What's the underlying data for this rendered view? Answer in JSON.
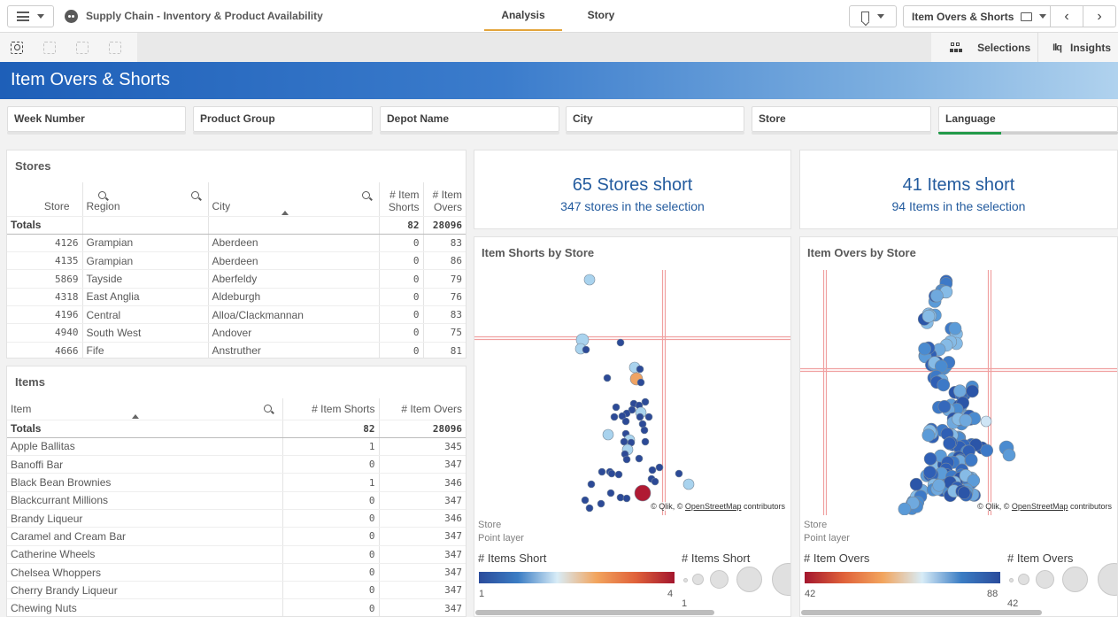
{
  "app": {
    "title": "Supply Chain - Inventory & Product Availability",
    "tabs": [
      {
        "label": "Analysis",
        "active": true
      },
      {
        "label": "Story",
        "active": false
      }
    ],
    "sheet_selector": "Item Overs & Shorts",
    "toolbar_right": {
      "selections_label": "Selections",
      "insights_label": "Insights"
    }
  },
  "sheet": {
    "title": "Item Overs & Shorts"
  },
  "filters": [
    {
      "label": "Week Number"
    },
    {
      "label": "Product Group"
    },
    {
      "label": "Depot Name"
    },
    {
      "label": "City"
    },
    {
      "label": "Store"
    },
    {
      "label": "Language",
      "selected_fraction": 0.35
    }
  ],
  "stores_table": {
    "title": "Stores",
    "columns": [
      "Store",
      "Region",
      "City",
      "# Item Shorts",
      "# Item Overs"
    ],
    "totals": {
      "label": "Totals",
      "shorts": "82",
      "overs": "28096"
    },
    "rows": [
      {
        "store": "4126",
        "region": "Grampian",
        "city": "Aberdeen",
        "shorts": "0",
        "overs": "83"
      },
      {
        "store": "4135",
        "region": "Grampian",
        "city": "Aberdeen",
        "shorts": "0",
        "overs": "86"
      },
      {
        "store": "5869",
        "region": "Tayside",
        "city": "Aberfeldy",
        "shorts": "0",
        "overs": "79"
      },
      {
        "store": "4318",
        "region": "East Anglia",
        "city": "Aldeburgh",
        "shorts": "0",
        "overs": "76"
      },
      {
        "store": "4196",
        "region": "Central",
        "city": "Alloa/Clackmannan",
        "shorts": "0",
        "overs": "83"
      },
      {
        "store": "4940",
        "region": "South West",
        "city": "Andover",
        "shorts": "0",
        "overs": "75"
      },
      {
        "store": "4666",
        "region": "Fife",
        "city": "Anstruther",
        "shorts": "0",
        "overs": "81"
      }
    ]
  },
  "items_table": {
    "title": "Items",
    "columns": [
      "Item",
      "# Item Shorts",
      "# Item Overs"
    ],
    "totals": {
      "label": "Totals",
      "shorts": "82",
      "overs": "28096"
    },
    "rows": [
      {
        "item": "Apple Ballitas",
        "shorts": "1",
        "overs": "345"
      },
      {
        "item": "Banoffi Bar",
        "shorts": "0",
        "overs": "347"
      },
      {
        "item": "Black Bean Brownies",
        "shorts": "1",
        "overs": "346"
      },
      {
        "item": "Blackcurrant Millions",
        "shorts": "0",
        "overs": "347"
      },
      {
        "item": "Brandy Liqueur",
        "shorts": "0",
        "overs": "346"
      },
      {
        "item": "Caramel and Cream Bar",
        "shorts": "0",
        "overs": "347"
      },
      {
        "item": "Catherine Wheels",
        "shorts": "0",
        "overs": "347"
      },
      {
        "item": "Chelsea Whoppers",
        "shorts": "0",
        "overs": "347"
      },
      {
        "item": "Cherry Brandy Liqueur",
        "shorts": "0",
        "overs": "347"
      },
      {
        "item": "Chewing Nuts",
        "shorts": "0",
        "overs": "347"
      }
    ]
  },
  "kpis": [
    {
      "main": "65 Stores short",
      "sub": "347 stores in the selection"
    },
    {
      "main": "41 Items short",
      "sub": "94 Items in the selection"
    }
  ],
  "maps": [
    {
      "title": "Item Shorts by Store",
      "attribution_prefix": "© Qlik, © ",
      "attribution_link": "OpenStreetMap",
      "attribution_suffix": " contributors",
      "layer_name": "Store",
      "layer_type": "Point layer",
      "color_legend_title": "# Items Short",
      "color_min": "1",
      "color_max": "4",
      "size_legend_title": "# Items Short",
      "size_min": "1",
      "gradient": [
        "#2a4b9b",
        "#3b7dc4",
        "#d8ecf7",
        "#f2a55e",
        "#e0623a",
        "#a3162e"
      ]
    },
    {
      "title": "Item Overs by Store",
      "attribution_prefix": "© Qlik, © ",
      "attribution_link": "OpenStreetMap",
      "attribution_suffix": " contributors",
      "layer_name": "Store",
      "layer_type": "Point layer",
      "color_legend_title": "# Item Overs",
      "color_min": "42",
      "color_max": "88",
      "size_legend_title": "# Item Overs",
      "size_min": "42",
      "gradient": [
        "#a3162e",
        "#e0623a",
        "#f2a55e",
        "#d8ecf7",
        "#3b7dc4",
        "#2a4b9b"
      ]
    }
  ],
  "colors": {
    "accent_tab": "#e3a43b",
    "kpi_text": "#235b9e",
    "language_bar": "#239a4a",
    "point_dark": "#2c4a97",
    "point_light": "#a9d3ee",
    "point_orange": "#f0a363",
    "point_red": "#b01a33"
  }
}
